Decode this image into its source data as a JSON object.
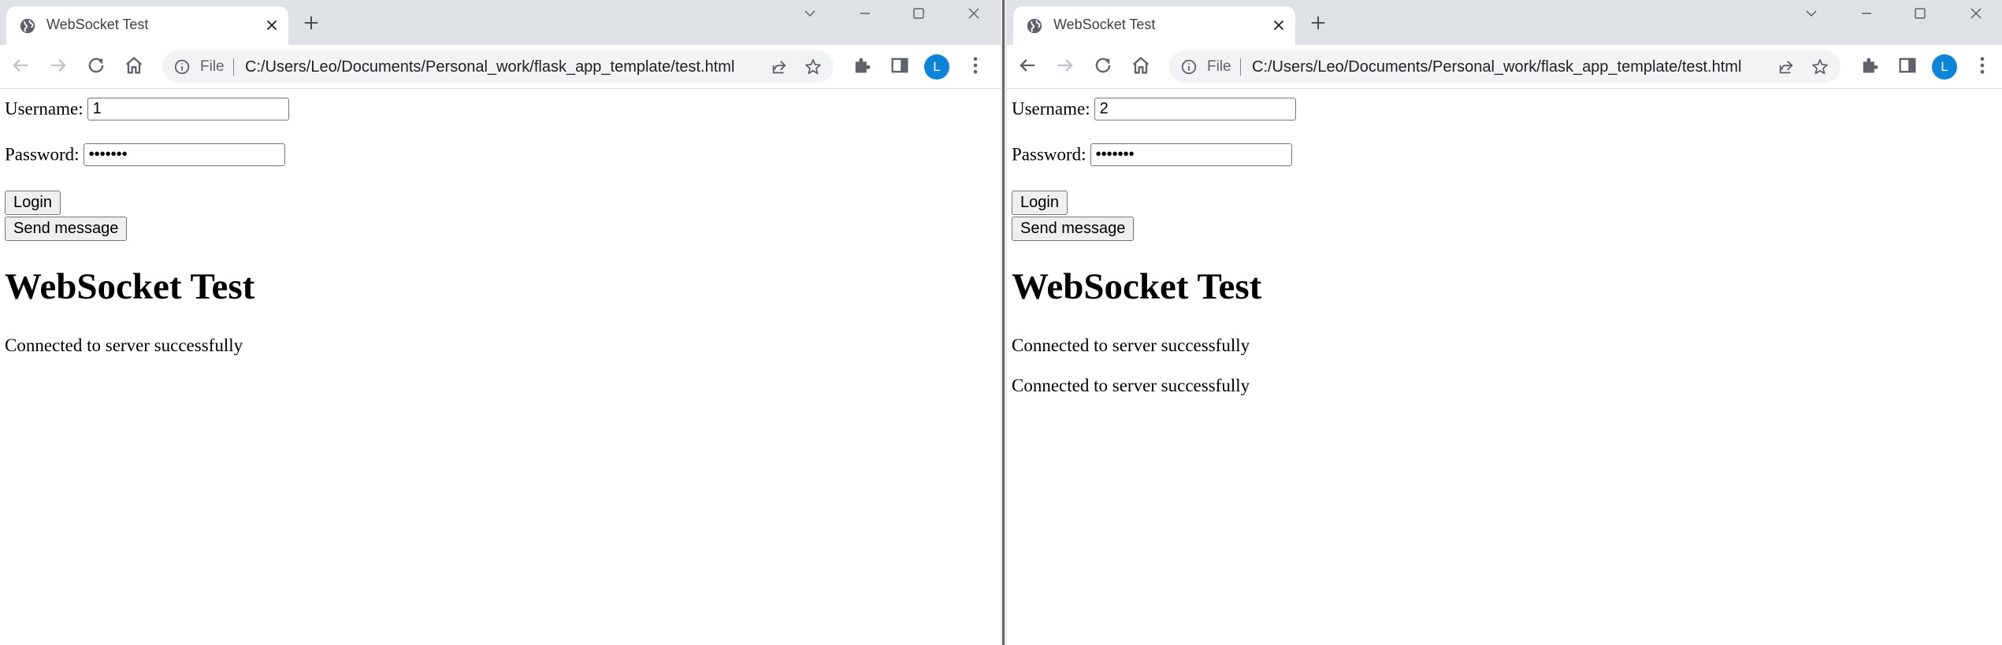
{
  "windows": [
    {
      "id": "left",
      "tab": {
        "title": "WebSocket Test"
      },
      "address_bar": {
        "scheme_label": "File",
        "url": "C:/Users/Leo/Documents/Personal_work/flask_app_template/test.html"
      },
      "profile_initial": "L",
      "form": {
        "username_label": "Username:",
        "username_value": "1",
        "password_label": "Password:",
        "password_value": "1234567",
        "login_label": "Login",
        "send_label": "Send message"
      },
      "heading": "WebSocket Test",
      "messages": [
        "Connected to server successfully"
      ]
    },
    {
      "id": "right",
      "tab": {
        "title": "WebSocket Test"
      },
      "address_bar": {
        "scheme_label": "File",
        "url": "C:/Users/Leo/Documents/Personal_work/flask_app_template/test.html"
      },
      "profile_initial": "L",
      "form": {
        "username_label": "Username:",
        "username_value": "2",
        "password_label": "Password:",
        "password_value": "1234567",
        "login_label": "Login",
        "send_label": "Send message"
      },
      "heading": "WebSocket Test",
      "messages": [
        "Connected to server successfully",
        "Connected to server successfully"
      ]
    }
  ],
  "icons": {
    "favicon": "globe-icon",
    "tab_close": "close-icon",
    "new_tab": "plus-icon",
    "back": "back-arrow-icon",
    "forward": "forward-arrow-icon",
    "reload": "reload-icon",
    "home": "home-icon",
    "site_info": "info-icon",
    "share": "share-icon",
    "bookmark": "star-icon",
    "extensions": "puzzle-icon",
    "side_panel": "side-panel-icon",
    "menu": "kebab-menu-icon"
  },
  "colors": {
    "tabstrip": "#dee1e6",
    "omnibox": "#f1f3f4",
    "avatar": "#0b84d9",
    "divider": "#666666"
  }
}
